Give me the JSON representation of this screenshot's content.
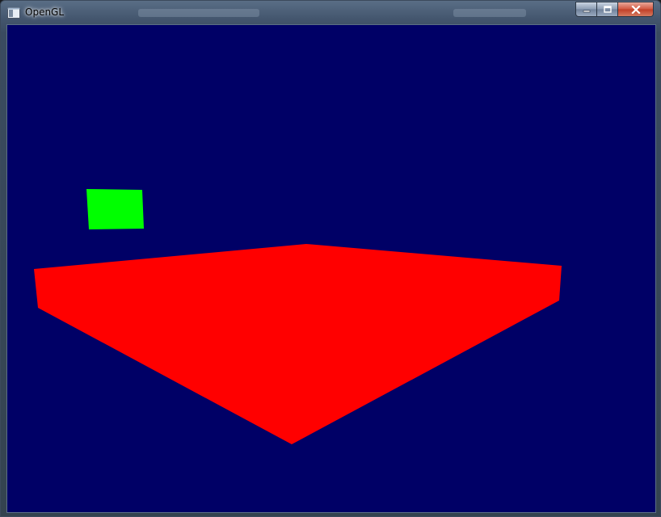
{
  "window": {
    "title": "OpenGL",
    "icon": "window-app-icon",
    "buttons": {
      "minimize_icon": "minimize-icon",
      "maximize_icon": "maximize-icon",
      "close_icon": "close-icon"
    }
  },
  "scene": {
    "background_color": "#000066",
    "objects": [
      {
        "name": "green-quad",
        "color": "#00ff00"
      },
      {
        "name": "red-plane",
        "color": "#ff0000"
      }
    ]
  }
}
